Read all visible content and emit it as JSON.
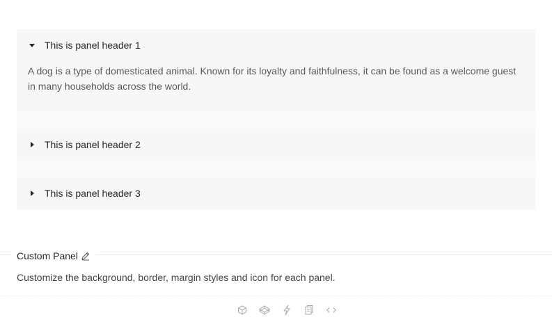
{
  "collapse": {
    "panels": [
      {
        "header": "This is panel header 1",
        "expanded": true,
        "content": "A dog is a type of domesticated animal. Known for its loyalty and faithfulness, it can be found as a welcome guest in many households across the world."
      },
      {
        "header": "This is panel header 2",
        "expanded": false
      },
      {
        "header": "This is panel header 3",
        "expanded": false
      }
    ],
    "arrow_icon": "caret-right-icon"
  },
  "demo": {
    "title": "Custom Panel",
    "title_icon": "edit-icon",
    "description": "Customize the background, border, margin styles and icon for each panel."
  },
  "actions": [
    "codesandbox-icon",
    "codepen-icon",
    "riddle-icon",
    "copy-icon",
    "code-icon"
  ],
  "colors": {
    "panel_bg": "#f7f7f7",
    "text": "rgba(0,0,0,0.85)",
    "icon_gray": "#aaaaaa"
  }
}
